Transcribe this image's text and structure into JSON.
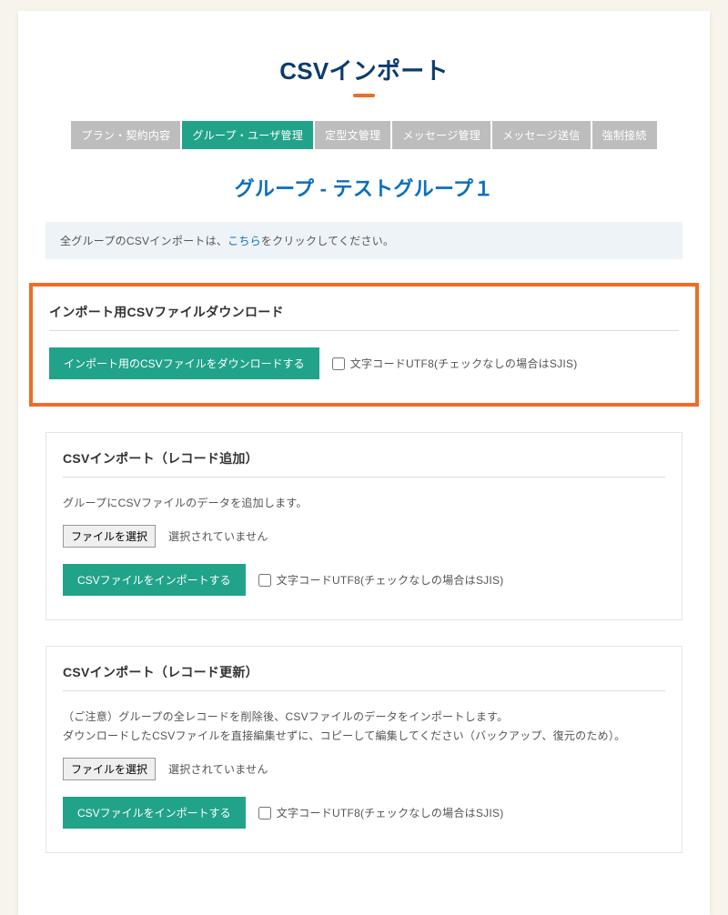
{
  "title": "CSVインポート",
  "tabs": [
    {
      "label": "プラン・契約内容"
    },
    {
      "label": "グループ・ユーザ管理"
    },
    {
      "label": "定型文管理"
    },
    {
      "label": "メッセージ管理"
    },
    {
      "label": "メッセージ送信"
    },
    {
      "label": "強制接続"
    }
  ],
  "active_tab_index": 1,
  "group_heading": "グループ - テストグループ１",
  "notice": {
    "prefix": "全グループのCSVインポートは、",
    "link": "こちら",
    "suffix": "をクリックしてください。"
  },
  "encoding_checkbox_label": "文字コードUTF8(チェックなしの場合はSJIS)",
  "file_choose_label": "ファイルを選択",
  "file_none_label": "選択されていません",
  "download": {
    "heading": "インポート用CSVファイルダウンロード",
    "button": "インポート用のCSVファイルをダウンロードする"
  },
  "import_add": {
    "heading": "CSVインポート（レコード追加）",
    "desc": "グループにCSVファイルのデータを追加します。",
    "button": "CSVファイルをインポートする"
  },
  "import_update": {
    "heading": "CSVインポート（レコード更新）",
    "desc_line1": "（ご注意）グループの全レコードを削除後、CSVファイルのデータをインポートします。",
    "desc_line2": "ダウンロードしたCSVファイルを直接編集せずに、コピーして編集してください（バックアップ、復元のため）。",
    "button": "CSVファイルをインポートする"
  }
}
